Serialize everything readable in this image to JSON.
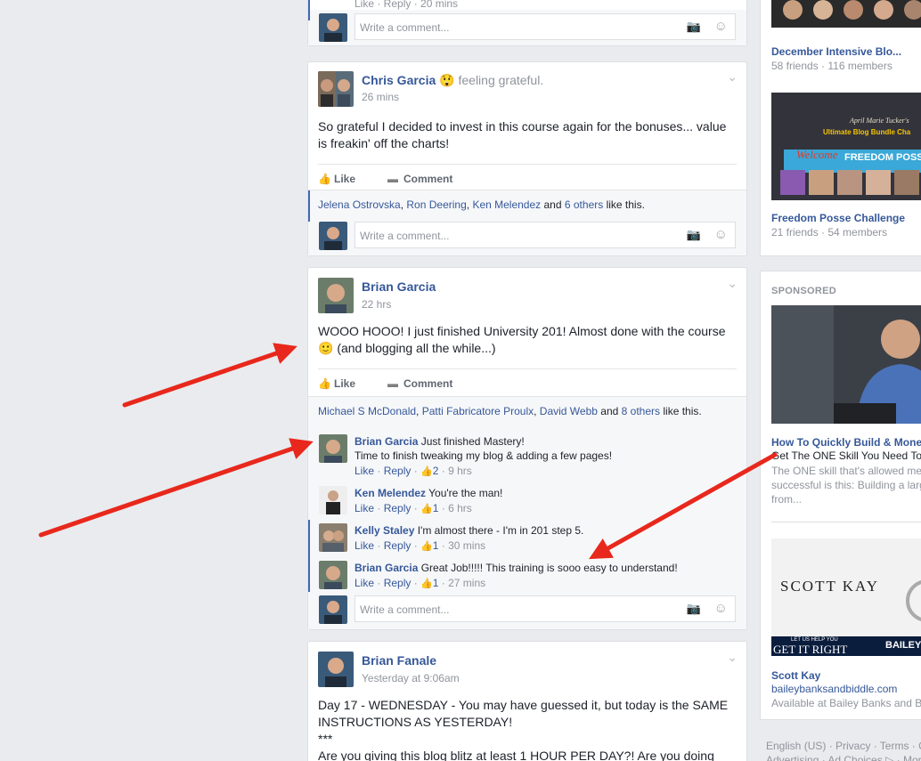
{
  "top_card": {
    "meta_partial": "Like · Reply · 20 mins",
    "comment_placeholder": "Write a comment..."
  },
  "post1": {
    "author": "Chris Garcia",
    "feeling": "feeling grateful.",
    "time": "26 mins",
    "text": "So grateful I decided to invest in this course again for the bonuses... value is freakin' off the charts!",
    "like_label": "Like",
    "comment_label": "Comment",
    "likers": [
      "Jelena Ostrovska",
      "Ron Deering",
      "Ken Melendez"
    ],
    "likers_and": "and",
    "others": "6 others",
    "like_this": "like this.",
    "comment_placeholder": "Write a comment..."
  },
  "post2": {
    "author": "Brian Garcia",
    "time": "22 hrs",
    "text": "WOOO HOOO! I just finished University 201! Almost done with the course 🙂 (and blogging all the while...)",
    "like_label": "Like",
    "comment_label": "Comment",
    "likers": [
      "Michael S McDonald",
      "Patti Fabricatore Proulx",
      "David Webb"
    ],
    "likers_and": "and",
    "others": "8 others",
    "like_this": "like this.",
    "comments": [
      {
        "name": "Brian Garcia",
        "text": "Just finished Mastery!",
        "text2": "Time to finish tweaking my blog & adding a few pages!",
        "like": "Like",
        "reply": "Reply",
        "likes": "2",
        "time": "9 hrs"
      },
      {
        "name": "Ken Melendez",
        "text": "You're the man!",
        "like": "Like",
        "reply": "Reply",
        "likes": "1",
        "time": "6 hrs"
      },
      {
        "name": "Kelly Staley",
        "text": "I'm almost there - I'm in 201 step 5.",
        "like": "Like",
        "reply": "Reply",
        "likes": "1",
        "time": "30 mins"
      },
      {
        "name": "Brian Garcia",
        "text": "Great Job!!!!! This training is sooo easy to understand!",
        "like": "Like",
        "reply": "Reply",
        "likes": "1",
        "time": "27 mins"
      }
    ],
    "comment_placeholder": "Write a comment..."
  },
  "post3": {
    "author": "Brian Fanale",
    "time": "Yesterday at 9:06am",
    "text_line1": "Day 17 - WEDNESDAY - You may have guessed it, but today is the SAME",
    "text_line2": "INSTRUCTIONS AS YESTERDAY!",
    "text_line3": "***",
    "text_line4": "Are you giving this blog blitz at least 1 HOUR PER DAY?! Are you doing"
  },
  "sidebar": {
    "group1": {
      "title": "December Intensive Blo...",
      "meta": "58 friends · 116 members"
    },
    "group2": {
      "title": "Freedom Posse Challenge",
      "meta": "21 friends · 54 members",
      "banner_top": "April Marie Tucker's",
      "banner_mid": "Ultimate Blog Bundle Cha",
      "banner_welcome": "Welcome",
      "banner_posse": "FREEDOM POSS"
    },
    "sponsored_label": "SPONSORED",
    "ad1": {
      "title": "How To Quickly Build & Mone",
      "line": "Get The ONE Skill You Need To",
      "body": "The ONE skill that's allowed me successful is this: Building a larg from..."
    },
    "ad2": {
      "brand": "SCOTT KAY",
      "tag1": "LET US HELP YOU",
      "tag2": "GET IT RIGHT",
      "tag3": "BAILEY",
      "title": "Scott Kay",
      "link": "baileybanksandbiddle.com",
      "desc": "Available at Bailey Banks and B"
    },
    "footer1": "English (US) · Privacy · Terms · C",
    "footer2": "Advertising · Ad Choices ▷ · Mor"
  },
  "colors": {
    "link": "#365899",
    "bg": "#e9ebee",
    "arrow": "#e8281c"
  }
}
